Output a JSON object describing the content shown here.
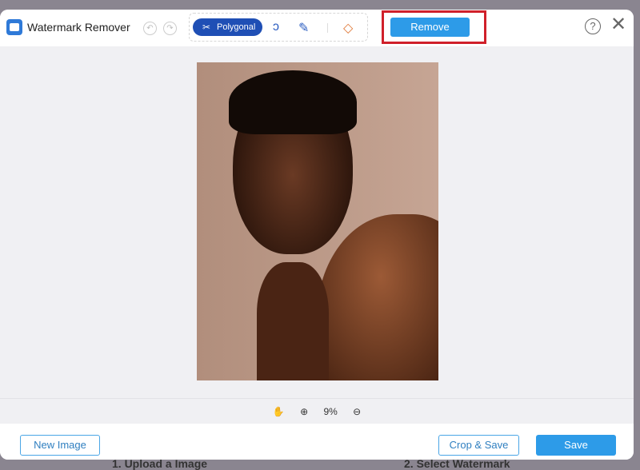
{
  "header": {
    "title": "Watermark Remover",
    "tools": {
      "polygonal": "Polygonal"
    },
    "remove": "Remove",
    "help": "?",
    "close": "✕"
  },
  "zoom": {
    "level": "9%"
  },
  "footer": {
    "new_image": "New Image",
    "crop_save": "Crop & Save",
    "save": "Save"
  },
  "backdrop": {
    "left": "1. Upload a Image",
    "right": "2. Select Watermark"
  },
  "colors": {
    "accent": "#2d9be8",
    "selected_tool": "#1f4fb5",
    "highlight": "#d0202a",
    "eraser": "#e07a3a"
  }
}
